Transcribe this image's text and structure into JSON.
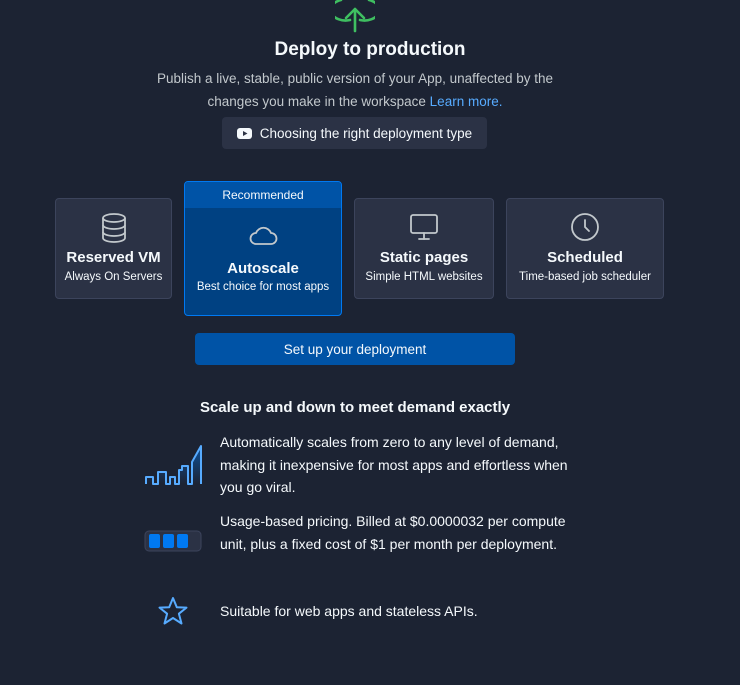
{
  "header": {
    "title": "Deploy to production",
    "description": "Publish a live, stable, public version of your App, unaffected by the changes you make in the workspace",
    "learn_more": "Learn more.",
    "video_button": "Choosing the right deployment type",
    "icon": "deploy-arrow-icon"
  },
  "deployment_types": [
    {
      "title": "Reserved VM",
      "subtitle": "Always On Servers",
      "icon": "database-icon"
    },
    {
      "title": "Autoscale",
      "subtitle": "Best choice for most apps",
      "badge": "Recommended",
      "icon": "cloud-icon",
      "selected": true
    },
    {
      "title": "Static pages",
      "subtitle": "Simple HTML websites",
      "icon": "monitor-icon"
    },
    {
      "title": "Scheduled",
      "subtitle": "Time-based job scheduler",
      "icon": "clock-icon"
    }
  ],
  "setup_button": "Set up your deployment",
  "details": {
    "heading": "Scale up and down to meet demand exactly",
    "features": [
      {
        "text": "Automatically scales from zero to any level of demand, making it inexpensive for most apps and effortless when you go viral.",
        "icon": "scaling-graph-icon"
      },
      {
        "text": "Usage-based pricing. Billed at $0.0000032 per compute unit, plus a fixed cost of $1 per month per deployment.",
        "icon": "battery-meter-icon"
      },
      {
        "text": "Suitable for web apps and stateless APIs.",
        "icon": "star-icon"
      }
    ]
  },
  "colors": {
    "background": "#1c2333",
    "card": "#2b3245",
    "accent": "#0079f2",
    "button": "#0053a6",
    "link": "#57abff",
    "deploy_icon": "#3fbf61"
  }
}
